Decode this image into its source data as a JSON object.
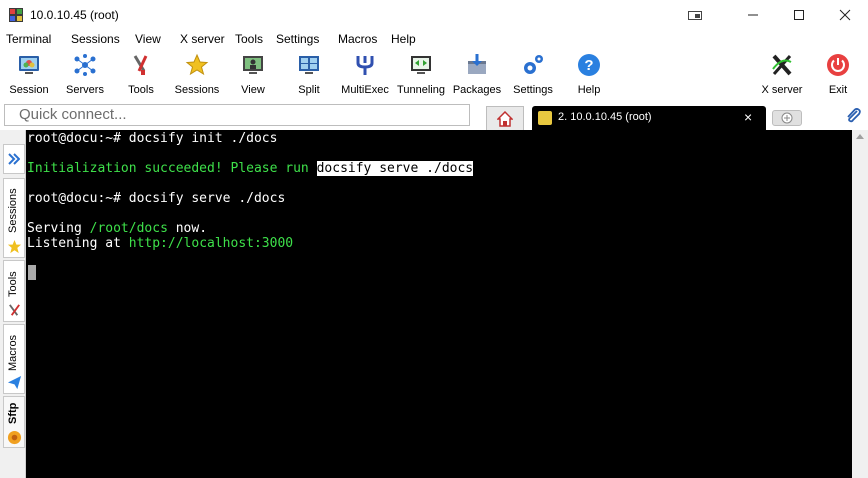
{
  "window": {
    "title": "10.0.10.45 (root)"
  },
  "menu": [
    "Terminal",
    "Sessions",
    "View",
    "X server",
    "Tools",
    "Settings",
    "Macros",
    "Help"
  ],
  "toolbar": [
    {
      "label": "Session",
      "icon": "session-icon"
    },
    {
      "label": "Servers",
      "icon": "servers-icon"
    },
    {
      "label": "Tools",
      "icon": "tools-icon"
    },
    {
      "label": "Sessions",
      "icon": "star-icon"
    },
    {
      "label": "View",
      "icon": "view-icon"
    },
    {
      "label": "Split",
      "icon": "split-icon"
    },
    {
      "label": "MultiExec",
      "icon": "multiexec-icon"
    },
    {
      "label": "Tunneling",
      "icon": "tunneling-icon"
    },
    {
      "label": "Packages",
      "icon": "packages-icon"
    },
    {
      "label": "Settings",
      "icon": "gears-icon"
    },
    {
      "label": "Help",
      "icon": "help-icon"
    },
    {
      "label": "X server",
      "icon": "x-server-icon"
    },
    {
      "label": "Exit",
      "icon": "power-icon"
    }
  ],
  "quick_connect": {
    "placeholder": "Quick connect..."
  },
  "tab": {
    "label": "2. 10.0.10.45 (root)"
  },
  "sidebar": [
    "Sessions",
    "Tools",
    "Macros",
    "Sftp"
  ],
  "terminal": {
    "line1": "root@docu:~# docsify init ./docs",
    "line2_green": "Initialization succeeded! Please run ",
    "line2_hl": "docsify serve ./docs",
    "line3": "root@docu:~# docsify serve ./docs",
    "line4_a": "Serving ",
    "line4_path": "/root/docs",
    "line4_b": " now.",
    "line5_a": "Listening at ",
    "line5_url": "http://localhost:3000"
  },
  "colors": {
    "terminal_bg": "#000000",
    "terminal_green": "#3ee04a"
  }
}
